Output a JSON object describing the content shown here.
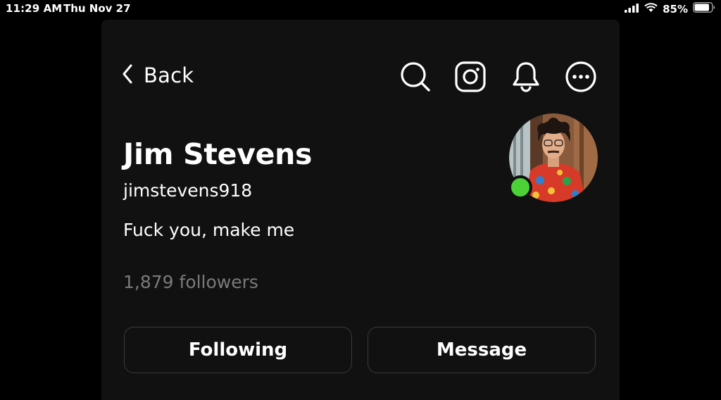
{
  "status_bar": {
    "time": "11:29 AM",
    "date": "Thu Nov 27",
    "battery_percent": "85%",
    "icons": [
      "cellular-signal-icon",
      "wifi-icon",
      "battery-icon"
    ]
  },
  "header": {
    "back_label": "Back",
    "icons": [
      "search-icon",
      "instagram-icon",
      "bell-icon",
      "more-icon"
    ]
  },
  "profile": {
    "name": "Jim Stevens",
    "handle": "jimstevens918",
    "bio": "Fuck you, make me",
    "followers": "1,879 followers",
    "online": true
  },
  "actions": {
    "following_label": "Following",
    "message_label": "Message"
  },
  "colors": {
    "background": "#000000",
    "panel": "#111111",
    "text": "#ffffff",
    "muted_text": "#7a7a7a",
    "online": "#4cd137",
    "button_border": "#3a3a3a"
  }
}
